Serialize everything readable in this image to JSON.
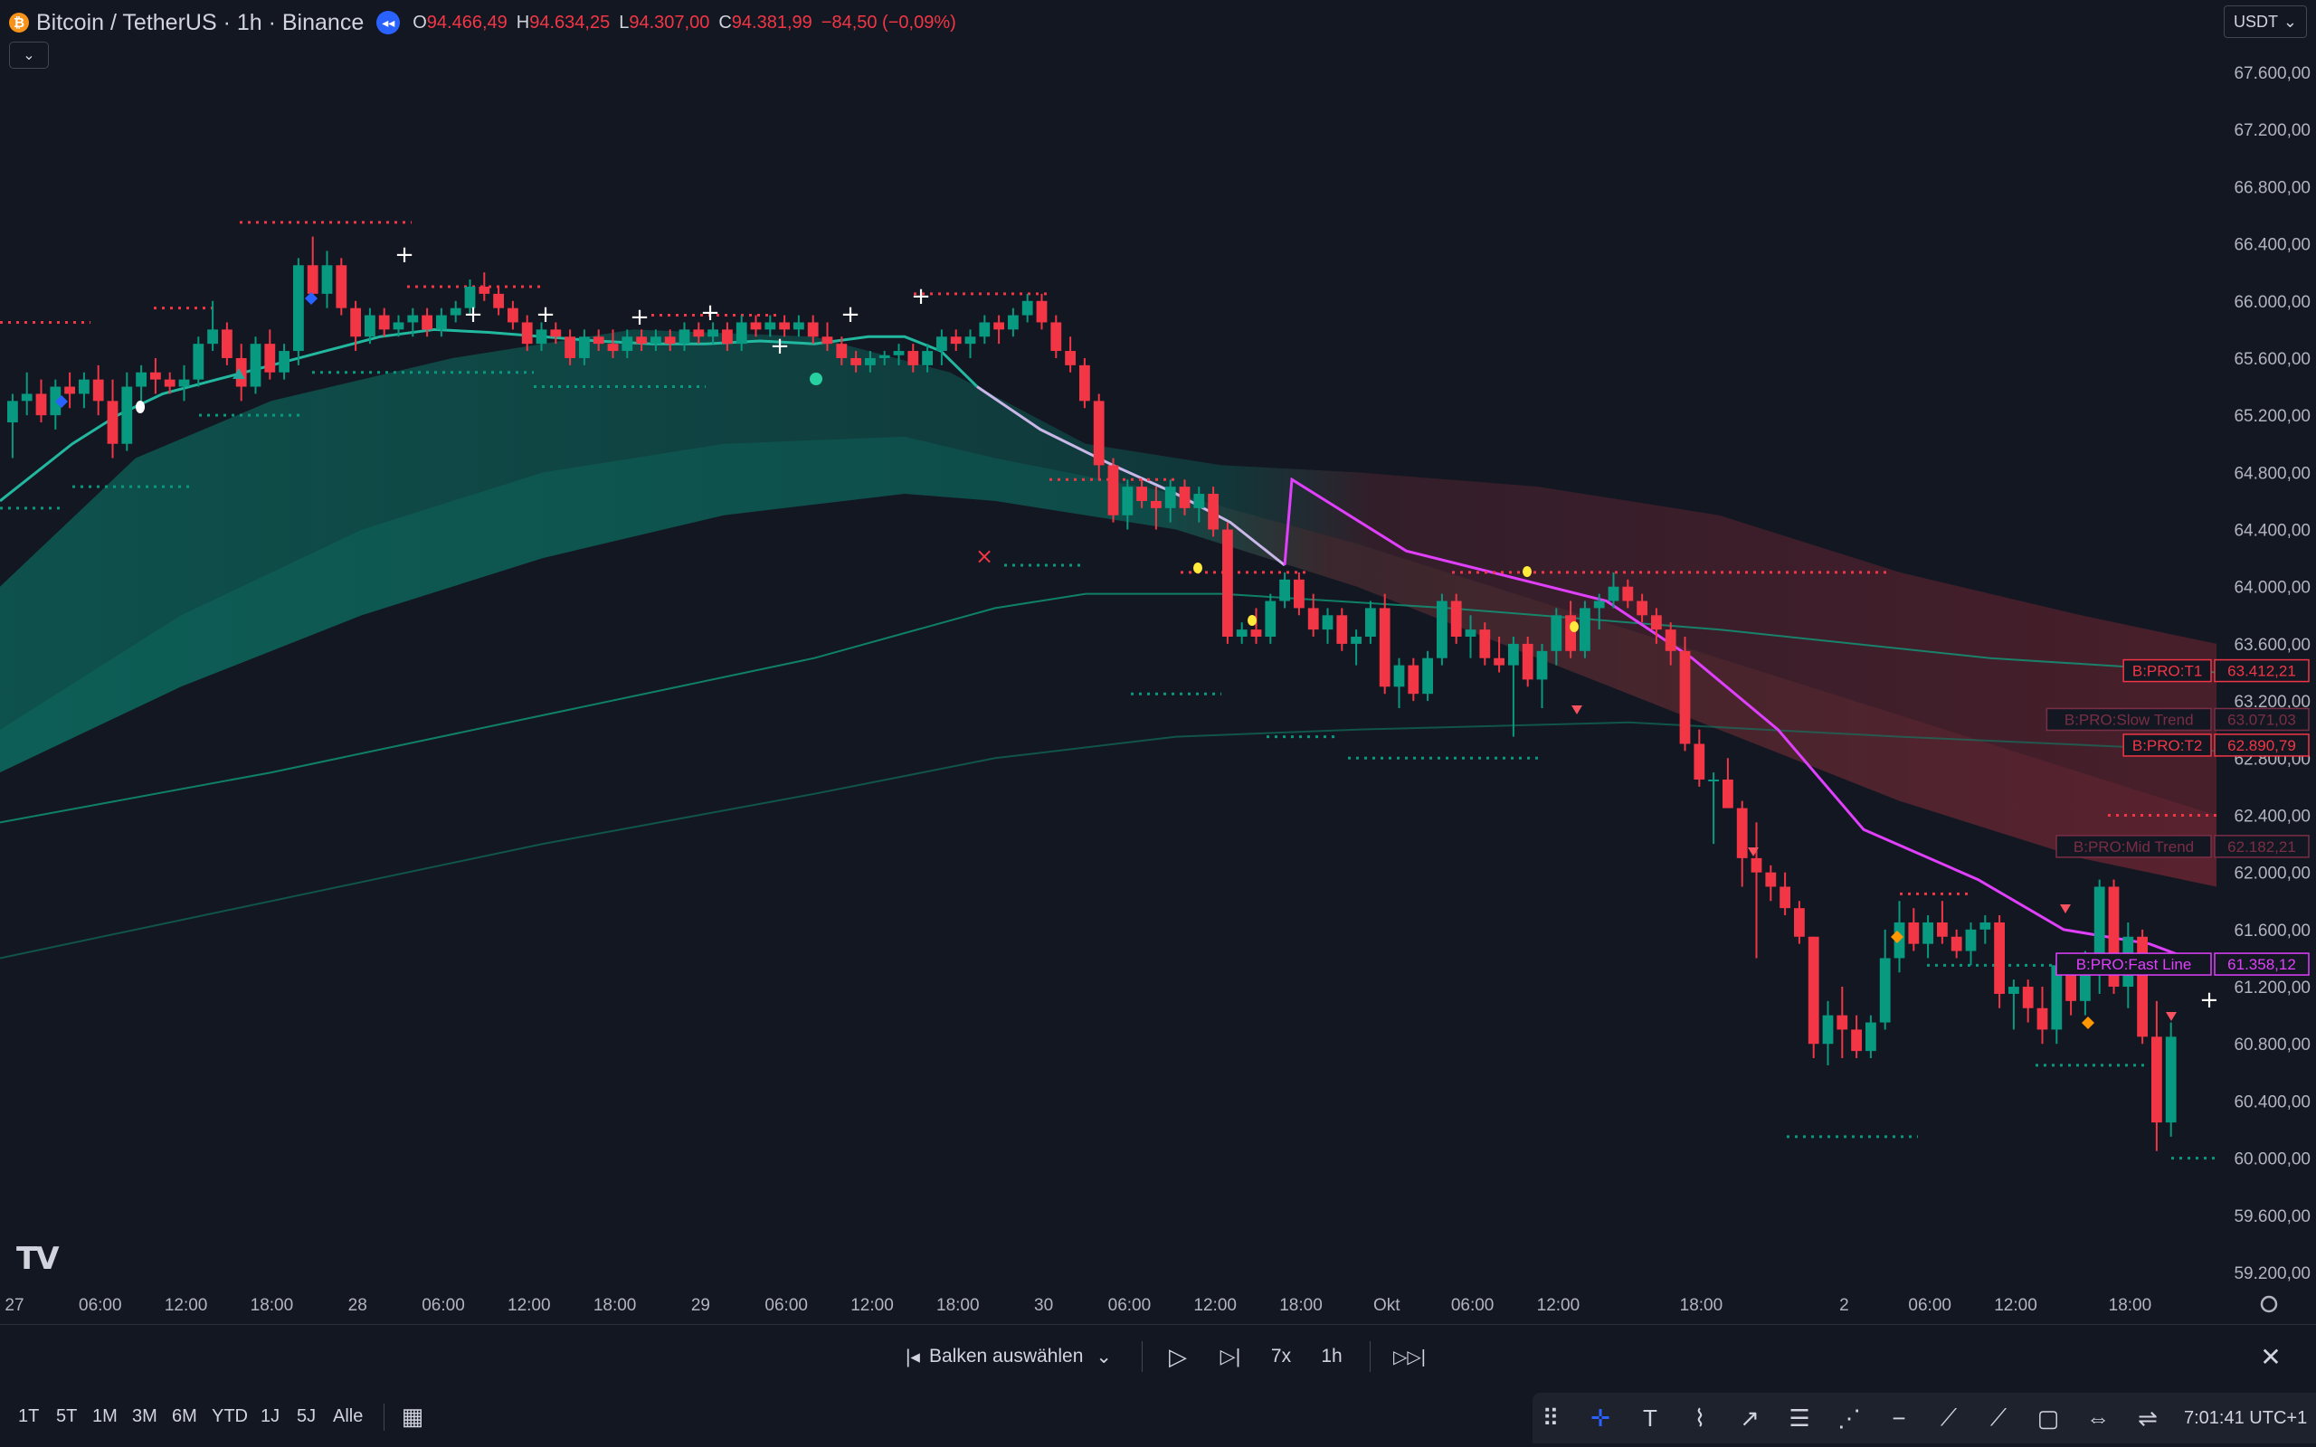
{
  "header": {
    "coin_glyph": "₿",
    "symbol": "Bitcoin / TetherUS · 1h · Binance",
    "replay_glyph": "◂◂",
    "ohlc": {
      "o_label": "O",
      "o": "94.466,49",
      "h_label": "H",
      "h": "94.634,25",
      "l_label": "L",
      "l": "94.307,00",
      "c_label": "C",
      "c": "94.381,99",
      "change": "−84,50 (−0,09%)"
    },
    "collapse_glyph": "⌄",
    "currency": "USDT",
    "currency_caret": "⌄"
  },
  "colors": {
    "background": "#131722",
    "up": "#089981",
    "down": "#f23645",
    "fast_line": "#e040fb",
    "axis_text": "#b2b5be"
  },
  "chart_data": {
    "type": "candlestick",
    "y_axis": {
      "ylim": [
        59000,
        67800
      ],
      "ticks": [
        67600,
        67200,
        66800,
        66400,
        66000,
        65600,
        65200,
        64800,
        64400,
        64000,
        63600,
        63200,
        62800,
        62400,
        62000,
        61600,
        61200,
        60800,
        60400,
        60000,
        59600,
        59200
      ],
      "tick_labels": [
        "67.600,00",
        "67.200,00",
        "66.800,00",
        "66.400,00",
        "66.000,00",
        "65.600,00",
        "65.200,00",
        "64.800,00",
        "64.400,00",
        "64.000,00",
        "63.600,00",
        "63.200,00",
        "62.800,00",
        "62.400,00",
        "62.000,00",
        "61.600,00",
        "61.200,00",
        "60.800,00",
        "60.400,00",
        "60.000,00",
        "59.600,00",
        "59.200,00"
      ]
    },
    "x_axis": {
      "tick_labels": [
        "27",
        "06:00",
        "12:00",
        "18:00",
        "28",
        "06:00",
        "12:00",
        "18:00",
        "29",
        "06:00",
        "12:00",
        "18:00",
        "30",
        "06:00",
        "12:00",
        "18:00",
        "Okt",
        "06:00",
        "12:00",
        "18:00",
        "2",
        "06:00",
        "12:00",
        "18:00"
      ],
      "tick_bars": [
        0,
        6,
        12,
        18,
        24,
        30,
        36,
        42,
        48,
        54,
        60,
        66,
        72,
        78,
        84,
        90,
        96,
        102,
        108,
        118,
        128,
        134,
        140,
        148
      ]
    },
    "candles": [
      [
        65150,
        65350,
        64900,
        65300
      ],
      [
        65300,
        65500,
        65200,
        65350
      ],
      [
        65350,
        65450,
        65150,
        65200
      ],
      [
        65200,
        65450,
        65100,
        65400
      ],
      [
        65400,
        65500,
        65250,
        65350
      ],
      [
        65350,
        65500,
        65250,
        65450
      ],
      [
        65450,
        65550,
        65200,
        65300
      ],
      [
        65300,
        65450,
        64900,
        65000
      ],
      [
        65000,
        65500,
        64950,
        65400
      ],
      [
        65400,
        65550,
        65300,
        65500
      ],
      [
        65500,
        65600,
        65350,
        65450
      ],
      [
        65450,
        65500,
        65350,
        65400
      ],
      [
        65400,
        65550,
        65300,
        65450
      ],
      [
        65450,
        65750,
        65400,
        65700
      ],
      [
        65700,
        66000,
        65650,
        65800
      ],
      [
        65800,
        65850,
        65550,
        65600
      ],
      [
        65600,
        65700,
        65300,
        65400
      ],
      [
        65400,
        65750,
        65350,
        65700
      ],
      [
        65700,
        65800,
        65450,
        65500
      ],
      [
        65500,
        65700,
        65450,
        65650
      ],
      [
        65650,
        66300,
        65550,
        66250
      ],
      [
        66250,
        66450,
        66000,
        66050
      ],
      [
        66050,
        66350,
        65950,
        66250
      ],
      [
        66250,
        66300,
        65900,
        65950
      ],
      [
        65950,
        66000,
        65650,
        65750
      ],
      [
        65750,
        65950,
        65700,
        65900
      ],
      [
        65900,
        65950,
        65750,
        65800
      ],
      [
        65800,
        65900,
        65750,
        65850
      ],
      [
        65850,
        65950,
        65750,
        65900
      ],
      [
        65900,
        65950,
        65750,
        65800
      ],
      [
        65800,
        65950,
        65750,
        65900
      ],
      [
        65900,
        66000,
        65850,
        65950
      ],
      [
        65950,
        66150,
        65900,
        66100
      ],
      [
        66100,
        66200,
        66000,
        66050
      ],
      [
        66050,
        66100,
        65900,
        65950
      ],
      [
        65950,
        66000,
        65800,
        65850
      ],
      [
        65850,
        65900,
        65650,
        65700
      ],
      [
        65700,
        65850,
        65650,
        65800
      ],
      [
        65800,
        65850,
        65700,
        65750
      ],
      [
        65750,
        65800,
        65550,
        65600
      ],
      [
        65600,
        65800,
        65550,
        65750
      ],
      [
        65750,
        65800,
        65650,
        65700
      ],
      [
        65700,
        65800,
        65600,
        65650
      ],
      [
        65650,
        65800,
        65600,
        65750
      ],
      [
        65750,
        65800,
        65650,
        65700
      ],
      [
        65700,
        65800,
        65650,
        65750
      ],
      [
        65750,
        65800,
        65650,
        65700
      ],
      [
        65700,
        65850,
        65650,
        65800
      ],
      [
        65800,
        65850,
        65700,
        65750
      ],
      [
        65750,
        65850,
        65700,
        65800
      ],
      [
        65800,
        65850,
        65650,
        65700
      ],
      [
        65700,
        65900,
        65650,
        65850
      ],
      [
        65850,
        65900,
        65750,
        65800
      ],
      [
        65800,
        65900,
        65750,
        65850
      ],
      [
        65850,
        65900,
        65750,
        65800
      ],
      [
        65800,
        65900,
        65750,
        65850
      ],
      [
        65850,
        65900,
        65700,
        65750
      ],
      [
        65750,
        65850,
        65650,
        65700
      ],
      [
        65700,
        65750,
        65550,
        65600
      ],
      [
        65600,
        65650,
        65500,
        65550
      ],
      [
        65550,
        65650,
        65500,
        65600
      ],
      [
        65600,
        65650,
        65550,
        65620
      ],
      [
        65620,
        65700,
        65550,
        65650
      ],
      [
        65650,
        65700,
        65500,
        65550
      ],
      [
        65550,
        65700,
        65500,
        65650
      ],
      [
        65650,
        65800,
        65550,
        65750
      ],
      [
        65750,
        65800,
        65650,
        65700
      ],
      [
        65700,
        65800,
        65600,
        65750
      ],
      [
        65750,
        65900,
        65700,
        65850
      ],
      [
        65850,
        65900,
        65700,
        65800
      ],
      [
        65800,
        65950,
        65750,
        65900
      ],
      [
        65900,
        66050,
        65850,
        66000
      ],
      [
        66000,
        66050,
        65800,
        65850
      ],
      [
        65850,
        65900,
        65600,
        65650
      ],
      [
        65650,
        65750,
        65500,
        65550
      ],
      [
        65550,
        65600,
        65250,
        65300
      ],
      [
        65300,
        65350,
        64750,
        64850
      ],
      [
        64850,
        64900,
        64450,
        64500
      ],
      [
        64500,
        64750,
        64400,
        64700
      ],
      [
        64700,
        64750,
        64550,
        64600
      ],
      [
        64600,
        64700,
        64400,
        64550
      ],
      [
        64550,
        64750,
        64450,
        64700
      ],
      [
        64700,
        64750,
        64500,
        64550
      ],
      [
        64550,
        64700,
        64450,
        64650
      ],
      [
        64650,
        64700,
        64350,
        64400
      ],
      [
        64400,
        64450,
        63600,
        63650
      ],
      [
        63650,
        63750,
        63600,
        63700
      ],
      [
        63700,
        63850,
        63600,
        63650
      ],
      [
        63650,
        63950,
        63600,
        63900
      ],
      [
        63900,
        64100,
        63850,
        64050
      ],
      [
        64050,
        64100,
        63800,
        63850
      ],
      [
        63850,
        63950,
        63650,
        63700
      ],
      [
        63700,
        63850,
        63600,
        63800
      ],
      [
        63800,
        63850,
        63550,
        63600
      ],
      [
        63600,
        63700,
        63450,
        63650
      ],
      [
        63650,
        63900,
        63600,
        63850
      ],
      [
        63850,
        63950,
        63250,
        63300
      ],
      [
        63300,
        63500,
        63150,
        63450
      ],
      [
        63450,
        63500,
        63200,
        63250
      ],
      [
        63250,
        63550,
        63200,
        63500
      ],
      [
        63500,
        63950,
        63450,
        63900
      ],
      [
        63900,
        63950,
        63600,
        63650
      ],
      [
        63650,
        63800,
        63500,
        63700
      ],
      [
        63700,
        63750,
        63450,
        63500
      ],
      [
        63500,
        63650,
        63400,
        63450
      ],
      [
        63450,
        63650,
        62950,
        63600
      ],
      [
        63600,
        63650,
        63300,
        63350
      ],
      [
        63350,
        63600,
        63150,
        63550
      ],
      [
        63550,
        63850,
        63450,
        63800
      ],
      [
        63800,
        63900,
        63500,
        63550
      ],
      [
        63550,
        63900,
        63500,
        63850
      ],
      [
        63850,
        63950,
        63700,
        63900
      ],
      [
        63900,
        64100,
        63850,
        64000
      ],
      [
        64000,
        64050,
        63850,
        63900
      ],
      [
        63900,
        63950,
        63750,
        63800
      ],
      [
        63800,
        63850,
        63600,
        63700
      ],
      [
        63700,
        63750,
        63450,
        63550
      ],
      [
        63550,
        63650,
        62850,
        62900
      ],
      [
        62900,
        63000,
        62600,
        62650
      ],
      [
        62650,
        62700,
        62200,
        62650
      ],
      [
        62650,
        62800,
        62450,
        62450
      ],
      [
        62450,
        62500,
        61900,
        62100
      ],
      [
        62100,
        62350,
        61400,
        62000
      ],
      [
        62000,
        62050,
        61800,
        61900
      ],
      [
        61900,
        62000,
        61700,
        61750
      ],
      [
        61750,
        61800,
        61500,
        61550
      ],
      [
        61550,
        61550,
        60700,
        60800
      ],
      [
        60800,
        61100,
        60650,
        61000
      ],
      [
        61000,
        61200,
        60700,
        60900
      ],
      [
        60900,
        61000,
        60700,
        60750
      ],
      [
        60750,
        61000,
        60700,
        60950
      ],
      [
        60950,
        61600,
        60900,
        61400
      ],
      [
        61400,
        61800,
        61300,
        61650
      ],
      [
        61650,
        61750,
        61450,
        61500
      ],
      [
        61500,
        61700,
        61400,
        61650
      ],
      [
        61650,
        61800,
        61500,
        61550
      ],
      [
        61550,
        61600,
        61400,
        61450
      ],
      [
        61450,
        61650,
        61350,
        61600
      ],
      [
        61600,
        61700,
        61500,
        61650
      ],
      [
        61650,
        61700,
        61050,
        61150
      ],
      [
        61150,
        61250,
        60900,
        61200
      ],
      [
        61200,
        61250,
        60950,
        61050
      ],
      [
        61050,
        61200,
        60800,
        60900
      ],
      [
        60900,
        61400,
        60800,
        61350
      ],
      [
        61350,
        61400,
        61000,
        61100
      ],
      [
        61100,
        61450,
        61000,
        61400
      ],
      [
        61400,
        61950,
        61150,
        61900
      ],
      [
        61900,
        61950,
        61150,
        61200
      ],
      [
        61200,
        61650,
        61050,
        61550
      ],
      [
        61550,
        61600,
        60800,
        60850
      ],
      [
        60850,
        61100,
        60050,
        60250
      ],
      [
        60250,
        60950,
        60150,
        60850
      ]
    ],
    "fast_line": [
      [
        90,
        64750
      ],
      [
        98,
        64250
      ],
      [
        106,
        64050
      ],
      [
        112,
        63900
      ],
      [
        118,
        63500
      ],
      [
        124,
        63000
      ],
      [
        130,
        62300
      ],
      [
        138,
        61950
      ],
      [
        144,
        61600
      ],
      [
        150,
        61500
      ],
      [
        154,
        61350
      ]
    ],
    "price_labels": [
      {
        "name": "B:PRO:T1",
        "value": "63.412,21",
        "price": 63412.21,
        "color": "#f23645"
      },
      {
        "name": "B:PRO:Slow Trend",
        "value": "63.071,03",
        "price": 63071.03,
        "color": "#7a2e45"
      },
      {
        "name": "B:PRO:T2",
        "value": "62.890,79",
        "price": 62890.79,
        "color": "#f23645"
      },
      {
        "name": "B:PRO:Mid Trend",
        "value": "62.182,21",
        "price": 62182.21,
        "color": "#7a2e45"
      },
      {
        "name": "B:PRO:Fast Line",
        "value": "61.358,12",
        "price": 61358.12,
        "color": "#e040fb"
      }
    ]
  },
  "replay_bar": {
    "select_bars_glyph": "|◂",
    "select_bars": "Balken auswählen",
    "select_caret": "⌄",
    "play_glyph": "▷",
    "step_glyph": "▷|",
    "speed": "7x",
    "interval": "1h",
    "jump_glyph": "▷▷|",
    "close_glyph": "✕"
  },
  "timeframes": [
    "1T",
    "5T",
    "1M",
    "3M",
    "6M",
    "YTD",
    "1J",
    "5J",
    "Alle"
  ],
  "calendar_glyph": "▦",
  "drawing_tools": [
    "⠿",
    "✛",
    "T",
    "⌇",
    "↗",
    "☰",
    "⋰",
    "−",
    "⟋",
    "⟋",
    "▢",
    "⇔",
    "⇌"
  ],
  "clock": "7:01:41 UTC+1",
  "tv_logo": "TV"
}
